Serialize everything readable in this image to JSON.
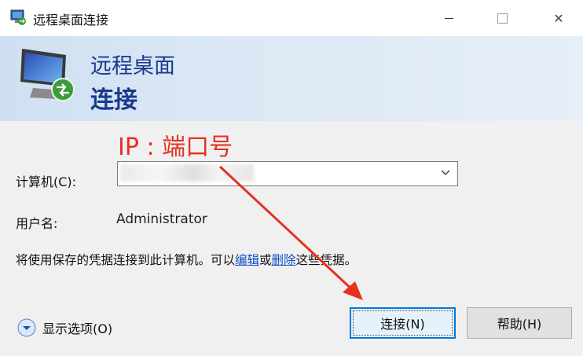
{
  "window": {
    "title": "远程桌面连接",
    "controls": {
      "minimize": "minimize",
      "maximize": "maximize",
      "close": "✕"
    }
  },
  "banner": {
    "line1": "远程桌面",
    "line2": "连接"
  },
  "annotation": {
    "text": "IP : 端口号",
    "color": "#e83020"
  },
  "form": {
    "computer_label": "计算机(C):",
    "computer_value": "",
    "username_label": "用户名:",
    "username_value": "Administrator",
    "info_prefix": "将使用保存的凭据连接到此计算机。可以",
    "edit_link": "编辑",
    "or": "或",
    "delete_link": "删除",
    "info_suffix": "这些凭据。"
  },
  "footer": {
    "options_label": "显示选项(O)",
    "connect_button": "连接(N)",
    "help_button": "帮助(H)"
  },
  "colors": {
    "accent": "#0078d7",
    "banner_text": "#1a3a8c",
    "link": "#0a4fc8"
  }
}
